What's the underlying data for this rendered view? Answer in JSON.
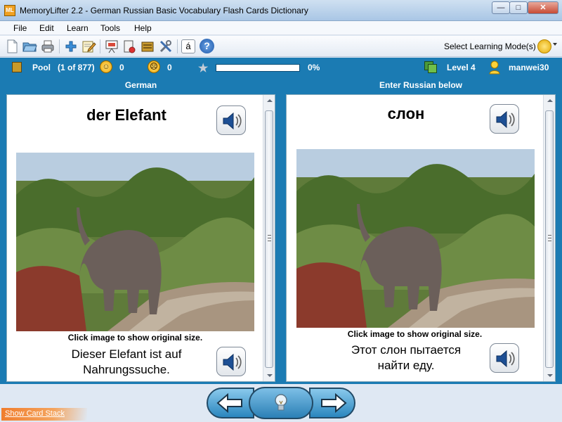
{
  "window": {
    "title": "MemoryLifter 2.2 - German Russian Basic Vocabulary Flash Cards Dictionary",
    "app_icon_text": "ML"
  },
  "menu": {
    "items": [
      "File",
      "Edit",
      "Learn",
      "Tools",
      "Help"
    ]
  },
  "toolbar": {
    "icons": [
      "new-file-icon",
      "open-folder-icon",
      "print-icon",
      "add-icon",
      "edit-icon",
      "slideshow-icon",
      "statistics-icon",
      "card-box-icon",
      "tools-icon",
      "character-map-icon",
      "help-icon"
    ],
    "character_map_label": "á",
    "help_label": "?",
    "learning_mode_label": "Select Learning Mode(s)"
  },
  "status": {
    "pool_label": "Pool",
    "pool_count": "(1 of 877)",
    "correct_count": "0",
    "wrong_count": "0",
    "progress_percent": 0,
    "progress_text": "0%",
    "level": "Level 4",
    "user": "manwei30",
    "colors": {
      "bar": "#1b7bb3",
      "progress": "#57d34a"
    }
  },
  "left_pane": {
    "header": "German",
    "word": "der Elefant",
    "caption": "Click image to show original size.",
    "sentence_line1": "Dieser Elefant ist auf",
    "sentence_line2": "Nahrungssuche."
  },
  "right_pane": {
    "header": "Enter Russian below",
    "word": "слон",
    "caption": "Click image to show original size.",
    "sentence_line1": "Этот слон пытается",
    "sentence_line2": "найти еду."
  },
  "bottom": {
    "card_stack_link": "Show Card Stack",
    "prev_icon": "arrow-left-icon",
    "hint_icon": "lightbulb-icon",
    "next_icon": "arrow-right-icon"
  }
}
